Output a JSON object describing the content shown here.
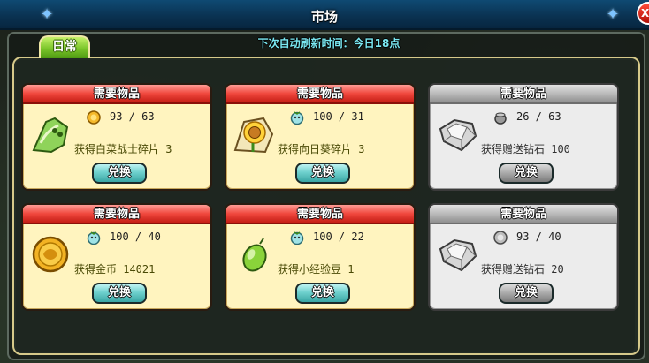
{
  "window": {
    "title": "市场",
    "close_label": "X"
  },
  "refresh_text": "下次自动刷新时间：今日18点",
  "tabs": [
    {
      "label": "日常"
    }
  ],
  "cards": [
    {
      "header": "需要物品",
      "cost_icon": "coin-icon",
      "cost": "93 / 63",
      "reward": "获得白菜战士碎片 3",
      "item_icon": "bok-choy-shard-icon",
      "button": "兑换",
      "state": "active"
    },
    {
      "header": "需要物品",
      "cost_icon": "plant-token-icon",
      "cost": "100 / 31",
      "reward": "获得向日葵碎片 3",
      "item_icon": "sunflower-shard-icon",
      "button": "兑换",
      "state": "active"
    },
    {
      "header": "需要物品",
      "cost_icon": "pot-icon",
      "cost": "26 / 63",
      "reward": "获得赠送钻石 100",
      "item_icon": "diamond-icon",
      "button": "兑换",
      "state": "disabled"
    },
    {
      "header": "需要物品",
      "cost_icon": "plant-token-icon",
      "cost": "100 / 40",
      "reward": "获得金币 14021",
      "item_icon": "gold-coin-icon",
      "button": "兑换",
      "state": "active"
    },
    {
      "header": "需要物品",
      "cost_icon": "plant-token-icon",
      "cost": "100 / 22",
      "reward": "获得小经验豆 1",
      "item_icon": "exp-bean-icon",
      "button": "兑换",
      "state": "active"
    },
    {
      "header": "需要物品",
      "cost_icon": "coin-icon",
      "cost": "93 / 40",
      "reward": "获得赠送钻石 20",
      "item_icon": "diamond-icon",
      "button": "兑换",
      "state": "disabled"
    }
  ]
}
